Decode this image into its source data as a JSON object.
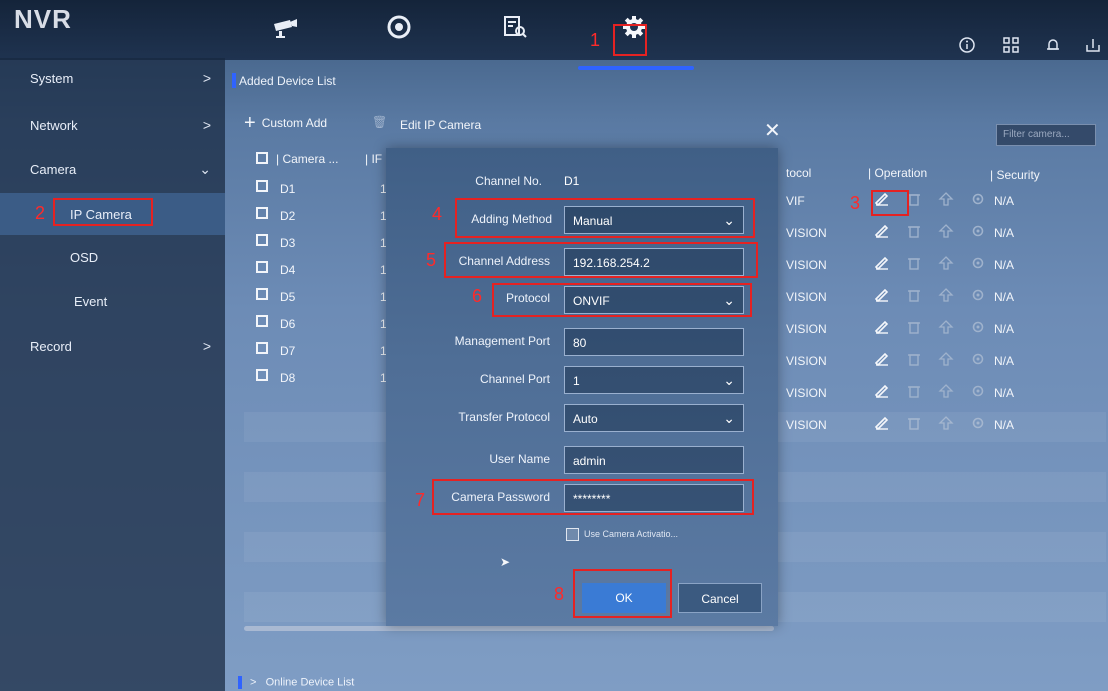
{
  "app": {
    "logo": "NVR"
  },
  "top_icons": [
    "camera-icon",
    "playback-icon",
    "search-file-icon",
    "settings-icon"
  ],
  "right_icons": [
    "info-icon",
    "qr-icon",
    "bell-icon",
    "export-icon"
  ],
  "sidebar": {
    "items": [
      {
        "label": "System",
        "chevron": ">"
      },
      {
        "label": "Network",
        "chevron": ">"
      },
      {
        "label": "Camera",
        "chevron": "⌄"
      },
      {
        "label": "IP Camera"
      },
      {
        "label": "OSD"
      },
      {
        "label": "Event"
      },
      {
        "label": "Record",
        "chevron": ">"
      }
    ]
  },
  "main": {
    "title": "Added Device List",
    "custom_add": "Custom Add",
    "edit_ip_camera": "Edit IP Camera",
    "search_placeholder": "Filter camera...",
    "headers": {
      "camera": "| Camera ...",
      "ip": "| IF",
      "protocol": "tocol",
      "operation": "| Operation",
      "security": "| Security"
    },
    "rows": [
      {
        "camera": "D1",
        "ip": "1",
        "protocol": "VIF",
        "security": "N/A"
      },
      {
        "camera": "D2",
        "ip": "1",
        "protocol": "VISION",
        "security": "N/A"
      },
      {
        "camera": "D3",
        "ip": "1",
        "protocol": "VISION",
        "security": "N/A"
      },
      {
        "camera": "D4",
        "ip": "1",
        "protocol": "VISION",
        "security": "N/A"
      },
      {
        "camera": "D5",
        "ip": "1",
        "protocol": "VISION",
        "security": "N/A"
      },
      {
        "camera": "D6",
        "ip": "1",
        "protocol": "VISION",
        "security": "N/A"
      },
      {
        "camera": "D7",
        "ip": "1",
        "protocol": "VISION",
        "security": "N/A"
      },
      {
        "camera": "D8",
        "ip": "1",
        "protocol": "VISION",
        "security": "N/A"
      }
    ],
    "online_device_list": "Online Device List"
  },
  "dialog": {
    "close": "✕",
    "channel_no_label": "Channel No.",
    "channel_no_value": "D1",
    "adding_method_label": "Adding Method",
    "adding_method_value": "Manual",
    "channel_address_label": "Channel Address",
    "channel_address_value": "192.168.254.2",
    "protocol_label": "Protocol",
    "protocol_value": "ONVIF",
    "management_port_label": "Management Port",
    "management_port_value": "80",
    "channel_port_label": "Channel Port",
    "channel_port_value": "1",
    "transfer_protocol_label": "Transfer Protocol",
    "transfer_protocol_value": "Auto",
    "user_name_label": "User Name",
    "user_name_value": "admin",
    "camera_password_label": "Camera Password",
    "camera_password_value": "********",
    "use_camera_activation": "Use Camera Activatio...",
    "ok": "OK",
    "cancel": "Cancel"
  },
  "annotations": [
    "1",
    "2",
    "3",
    "4",
    "5",
    "6",
    "7",
    "8"
  ],
  "colors": {
    "accent": "#2f63ff",
    "annotation": "#e52222",
    "ok_button": "#3a7bd5"
  }
}
